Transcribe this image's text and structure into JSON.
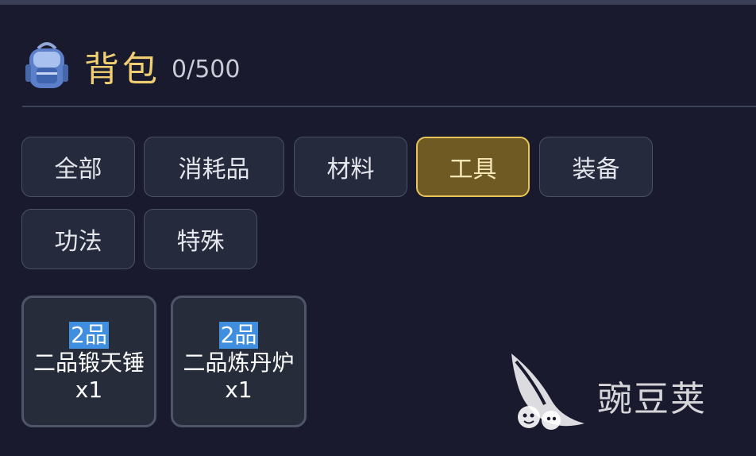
{
  "header": {
    "icon": "backpack-icon",
    "title": "背包",
    "capacity": "0/500"
  },
  "tabs": [
    {
      "label": "全部",
      "active": false
    },
    {
      "label": "消耗品",
      "active": false
    },
    {
      "label": "材料",
      "active": false
    },
    {
      "label": "工具",
      "active": true
    },
    {
      "label": "装备",
      "active": false
    },
    {
      "label": "功法",
      "active": false
    },
    {
      "label": "特殊",
      "active": false
    }
  ],
  "items": [
    {
      "grade": "2品",
      "name": "二品锻天锤",
      "quantity": "x1"
    },
    {
      "grade": "2品",
      "name": "二品炼丹炉",
      "quantity": "x1"
    }
  ],
  "watermark": {
    "icon": "peapod-logo-icon",
    "text": "豌豆荚"
  },
  "colors": {
    "background": "#1a1a2e",
    "accent_gold": "#e8c45b",
    "title_gold": "#f0cf72",
    "grade_badge": "#3f8ee0"
  }
}
